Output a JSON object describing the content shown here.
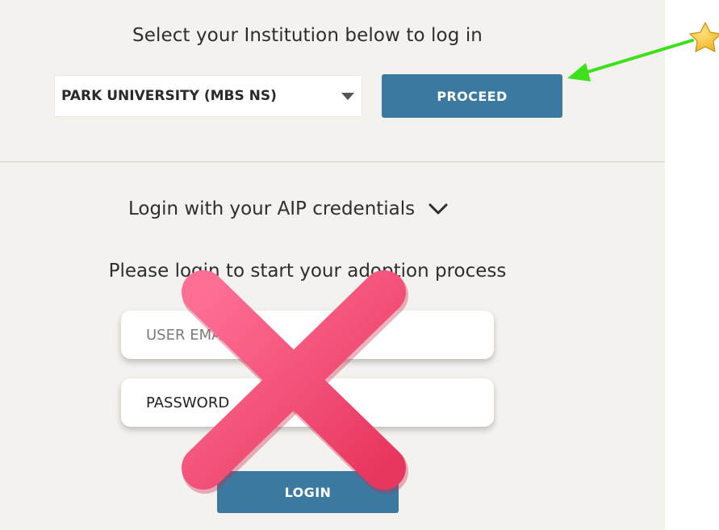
{
  "institution_section": {
    "heading": "Select your Institution below to log in",
    "selected_institution": "PARK UNIVERSITY (MBS NS)",
    "proceed_label": "PROCEED"
  },
  "aip_section": {
    "toggle_label": "Login with your AIP credentials",
    "prompt": "Please login to start your adoption process",
    "email_placeholder": "USER EMAIL",
    "password_placeholder": "PASSWORD",
    "login_label": "LOGIN"
  },
  "annotations": {
    "arrow_color": "#3ee01c",
    "cross_color": "#f2507a",
    "star_color": "#f7c53a",
    "icons": [
      "star-icon",
      "arrow-icon",
      "cross-mark-icon"
    ]
  },
  "colors": {
    "primary_button": "#3a7aa0",
    "panel_background": "#f4f2ef"
  }
}
